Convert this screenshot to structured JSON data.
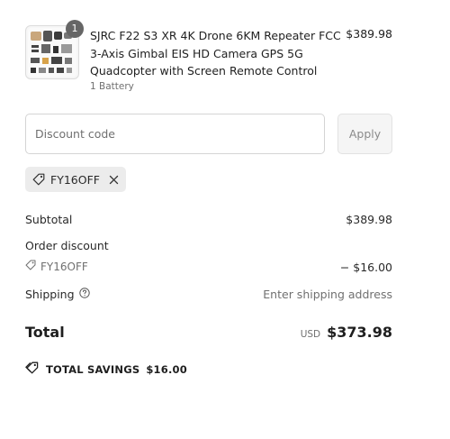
{
  "product": {
    "title": "SJRC F22 S3 XR 4K Drone 6KM Repeater FCC 3-Axis Gimbal EIS HD Camera GPS 5G Quadcopter with Screen Remote Control",
    "variant": "1 Battery",
    "price": "$389.98",
    "quantity": "1"
  },
  "discount": {
    "placeholder": "Discount code",
    "apply_label": "Apply",
    "applied_code": "FY16OFF"
  },
  "summary": {
    "subtotal_label": "Subtotal",
    "subtotal_value": "$389.98",
    "order_discount_label": "Order discount",
    "order_discount_code": "FY16OFF",
    "order_discount_value": "− $16.00",
    "shipping_label": "Shipping",
    "shipping_value": "Enter shipping address",
    "total_label": "Total",
    "currency": "USD",
    "total_value": "$373.98",
    "savings_label": "TOTAL SAVINGS",
    "savings_value": "$16.00"
  },
  "icons": [
    "tag-icon",
    "close-icon",
    "help-circle-icon",
    "tags-icon"
  ]
}
